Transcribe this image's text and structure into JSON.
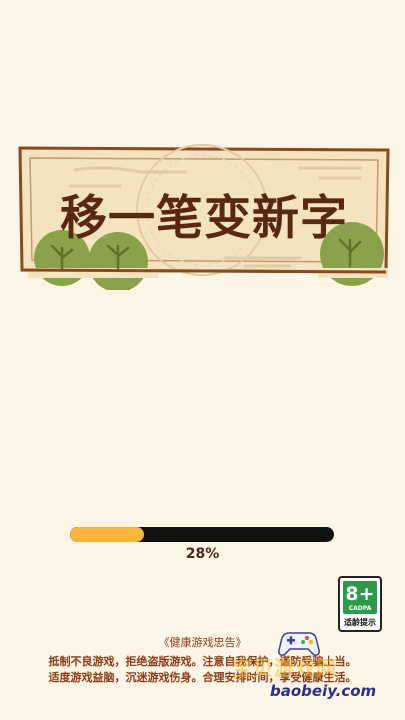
{
  "banner": {
    "title": "移一笔变新字"
  },
  "loading": {
    "progress": 0.28,
    "progress_text": "28%"
  },
  "age_rating": {
    "number": "8+",
    "org": "CADPA",
    "caption": "适龄提示"
  },
  "advisory": {
    "title": "《健康游戏忠告》",
    "line1": "抵制不良游戏，拒绝盗版游戏。注意自我保护，谨防受骗上当。",
    "line2": "适度游戏益脑，沉迷游戏伤身。合理安排时间，享受健康生活。"
  },
  "watermark": {
    "text_cn": "宝贝游戏网",
    "url": "baobeiy.com",
    "icon": "gamepad-icon"
  },
  "colors": {
    "background": "#fdf6e6",
    "title": "#5a2713",
    "progress_fill": "#f9b63b",
    "progress_track": "#111111",
    "advisory_text": "#8c3a16",
    "badge_green": "#2c9a49"
  }
}
